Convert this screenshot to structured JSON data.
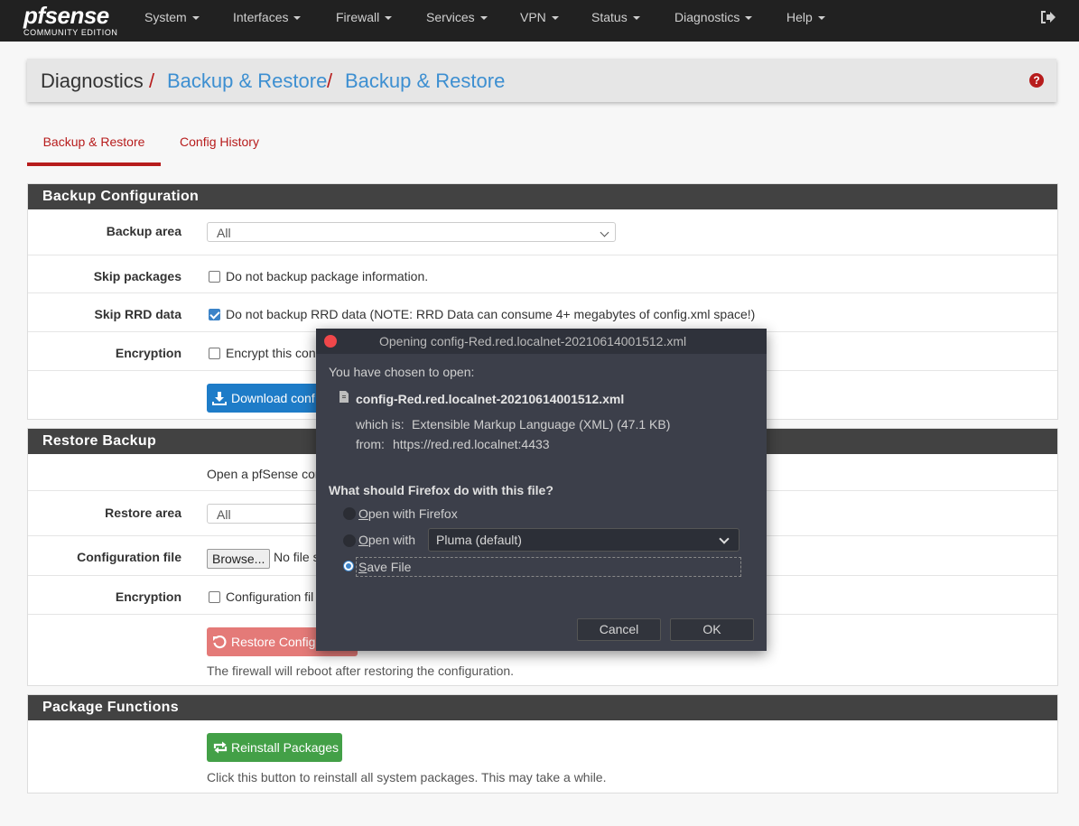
{
  "navbar": {
    "logo_main": "pfsense",
    "logo_sub": "COMMUNITY EDITION",
    "menu": [
      "System",
      "Interfaces",
      "Firewall",
      "Services",
      "VPN",
      "Status",
      "Diagnostics",
      "Help"
    ]
  },
  "breadcrumb": {
    "part1": "Diagnostics",
    "sep": "/",
    "part2": "Backup & Restore",
    "part3": "Backup & Restore",
    "help": "?"
  },
  "tabs": [
    "Backup & Restore",
    "Config History"
  ],
  "backup": {
    "title": "Backup Configuration",
    "area_label": "Backup area",
    "area_value": "All",
    "skip_pkg_label": "Skip packages",
    "skip_pkg_text": "Do not backup package information.",
    "skip_rrd_label": "Skip RRD data",
    "skip_rrd_text": "Do not backup RRD data (NOTE: RRD Data can consume 4+ megabytes of config.xml space!)",
    "enc_label": "Encryption",
    "enc_text": "Encrypt this con",
    "download_label": "Download conf"
  },
  "restore": {
    "title": "Restore Backup",
    "intro": "Open a pfSense cor",
    "area_label": "Restore area",
    "area_value": "All",
    "file_label": "Configuration file",
    "browse": "Browse...",
    "no_file": "No file s",
    "enc_label": "Encryption",
    "enc_text": "Configuration fil",
    "restore_label": "Restore Configu",
    "reboot_hint": "The firewall will reboot after restoring the configuration."
  },
  "packages": {
    "title": "Package Functions",
    "reinstall_label": "Reinstall Packages",
    "hint": "Click this button to reinstall all system packages. This may take a while."
  },
  "dialog": {
    "title": "Opening config-Red.red.localnet-20210614001512.xml",
    "chosen": "You have chosen to open:",
    "filename": "config-Red.red.localnet-20210614001512.xml",
    "which_label": "which is:",
    "which_value": "Extensible Markup Language (XML) (47.1 KB)",
    "from_label": "from:",
    "from_value": "https://red.red.localnet:4433",
    "question": "What should Firefox do with this file?",
    "opt_open_firefox_u": "O",
    "opt_open_firefox_rest": "pen with Firefox",
    "opt_open_with_u": "O",
    "opt_open_with_rest": "pen with",
    "app_select": "Pluma (default)",
    "opt_save_u": "S",
    "opt_save_rest": "ave File",
    "selected_option": "save-file",
    "cancel": "Cancel",
    "ok": "OK"
  },
  "colors": {
    "navbar": "#212121",
    "accent_red": "#b71c1c",
    "link_blue": "#3d8fd1",
    "panel_head": "#424242",
    "dialog_bg": "#3c3f4a"
  }
}
